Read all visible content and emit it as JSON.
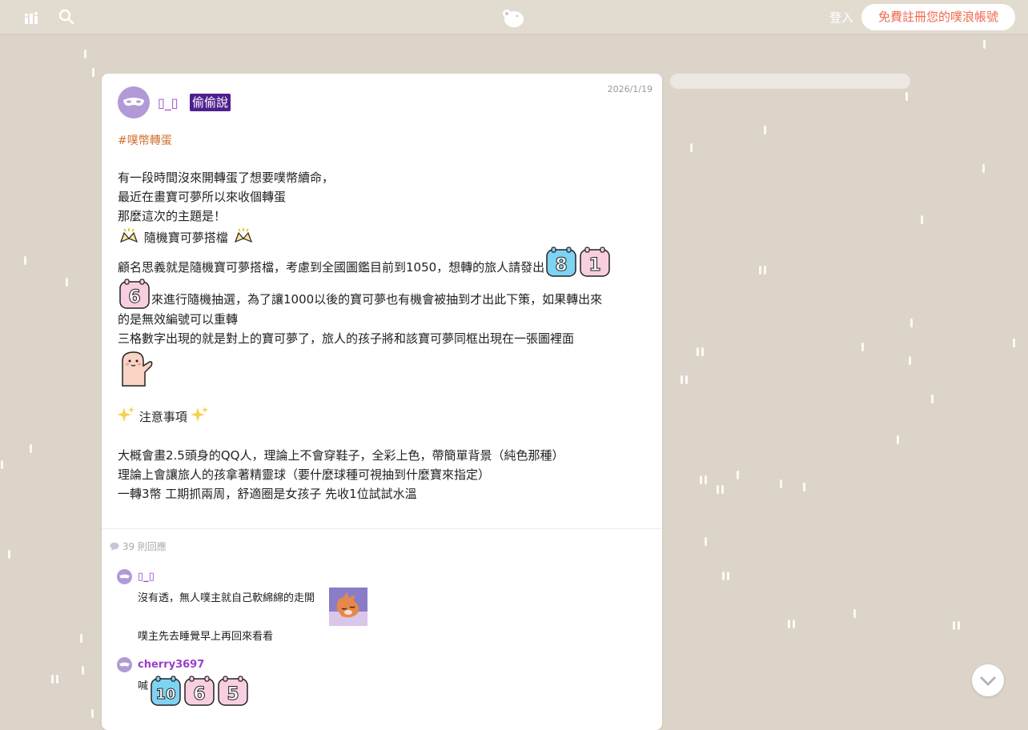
{
  "header": {
    "login_label": "登入",
    "signup_label": "免費註冊您的噗浪帳號"
  },
  "post": {
    "author": "▯_▯",
    "badge": "偷偷說",
    "date": "2026/1/19",
    "hashtag": "#噗幣轉蛋",
    "lines": {
      "l1": "有一段時間沒來開轉蛋了想要噗幣續命，",
      "l2": "最近在畫寶可夢所以來收個轉蛋",
      "l3": "那麼這次的主題是！",
      "theme": "隨機寶可夢搭檔",
      "l5": "顧名思義就是隨機寶可夢搭檔，考慮到全國圖鑑目前到1050，想轉的旅人請發出",
      "l6": "來進行隨機抽選，為了讓1000以後的寶可夢也有機會被抽到才出此下策，如果轉出來",
      "l7": "的是無效編號可以重轉",
      "l8": "三格數字出現的就是對上的寶可夢了，旅人的孩子將和該寶可夢同框出現在一張圖裡面",
      "notes_title": "注意事項",
      "n1": "大概會畫2.5頭身的QQ人，理論上不會穿鞋子，全彩上色，帶簡單背景（純色那種）",
      "n2": "理論上會讓旅人的孩拿著精靈球（要什麼球種可視抽到什麼寶來指定）",
      "n3": "一轉3幣 工期抓兩周，舒適圈是女孩子 先收1位試試水溫"
    },
    "dice_emoji": [
      "8",
      "1",
      "6"
    ]
  },
  "replies": {
    "count_label": "39 則回應",
    "items": [
      {
        "name": "▯_▯",
        "text1": "沒有透，無人噗主就自己軟綿綿的走開",
        "text2": "噗主先去睡覺早上再回來看看"
      },
      {
        "name": "cherry3697",
        "text1": "喊",
        "dice": [
          "10",
          "6",
          "5"
        ]
      }
    ]
  },
  "colors": {
    "background": "#dcd4c8",
    "accent_purple": "#9b3fc8",
    "hashtag_orange": "#d07232",
    "signup_text": "#f0684f",
    "badge_bg": "#4e1f8e"
  },
  "icons": [
    "chart-icon",
    "search-icon",
    "plurk-logo-icon",
    "scroll-down-icon",
    "comment-icon",
    "mask-avatar-icon"
  ]
}
